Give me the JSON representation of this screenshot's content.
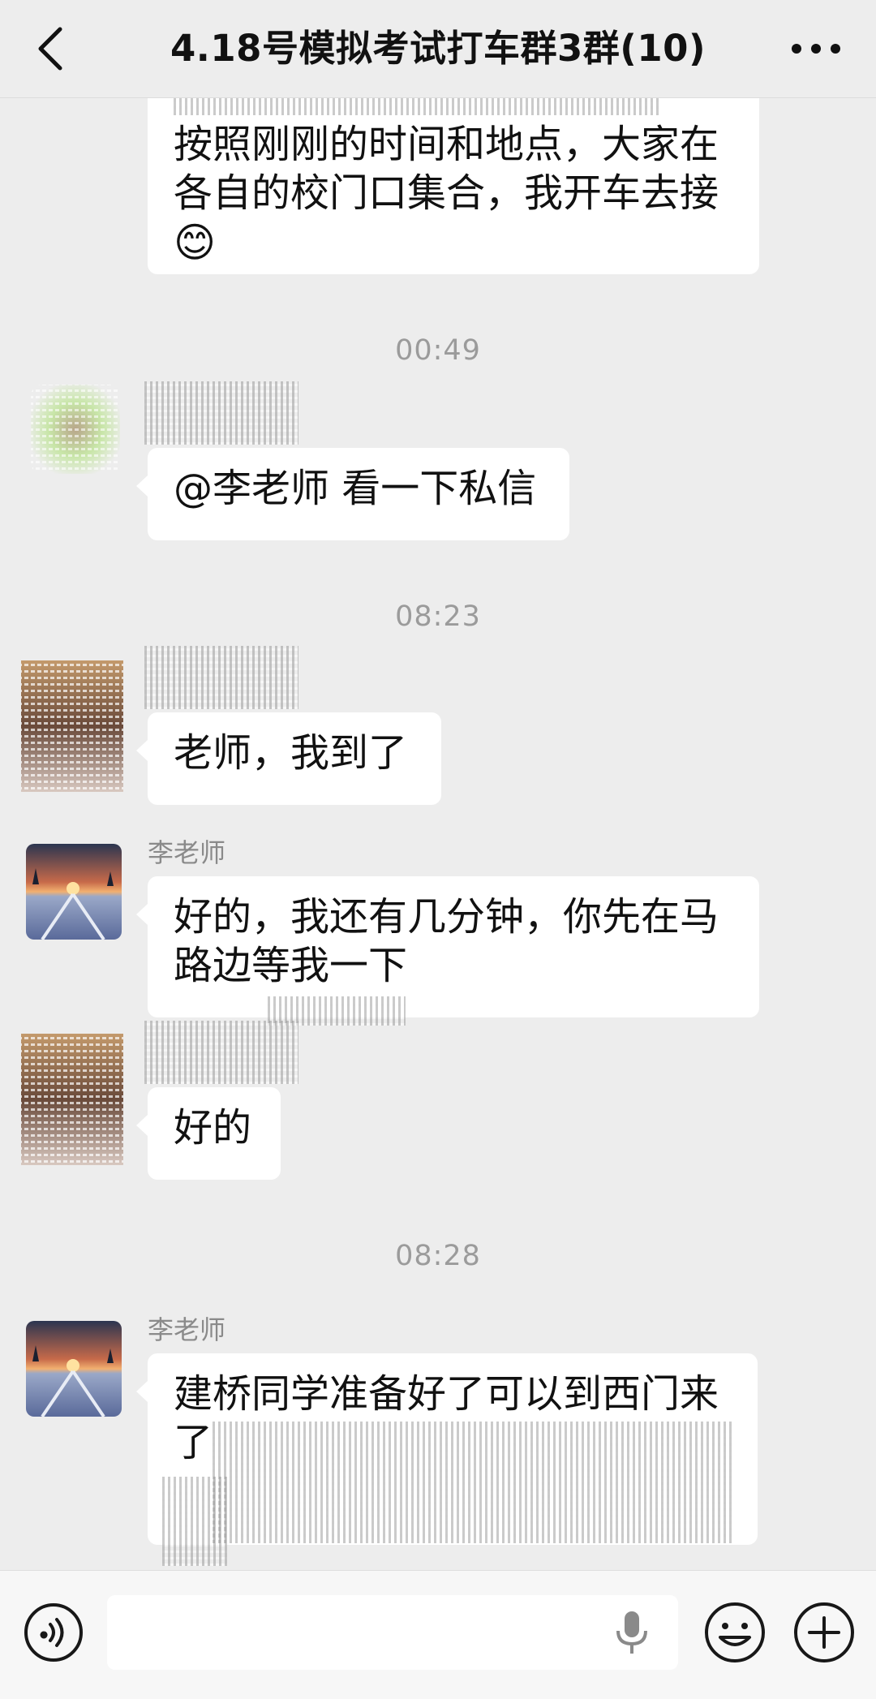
{
  "header": {
    "title": "4.18号模拟考试打车群3群(10)"
  },
  "messages": {
    "m1_line1": "按照刚刚的时间和地点，大家在",
    "m1_line2": "各自的校门口集合，我开车去接",
    "m1_emoji": "😊",
    "time1": "00:49",
    "m2": "@李老师 看一下私信",
    "time2": "08:23",
    "m3": "老师，我到了",
    "m4_sender": "李老师",
    "m4_line1": "好的，我还有几分钟，你先在马",
    "m4_line2": "路边等我一下",
    "m5": "好的",
    "time3": "08:28",
    "m6_sender": "李老师",
    "m6_line1": "建桥同学准备好了可以到西门来",
    "m6_line2": "了"
  },
  "colors": {
    "background": "#ededed",
    "bubble": "#ffffff",
    "timestamp": "#9b9b9b"
  },
  "icons": [
    "back-chevron-icon",
    "more-dots-icon",
    "voice-icon",
    "mic-icon",
    "emoji-icon",
    "plus-icon"
  ]
}
